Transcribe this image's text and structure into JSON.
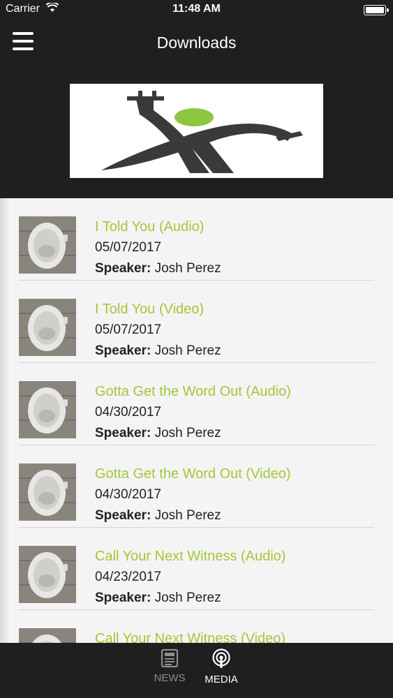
{
  "status_bar": {
    "carrier": "Carrier",
    "time": "11:48 AM"
  },
  "nav": {
    "title": "Downloads"
  },
  "colors": {
    "accent": "#a3c63a",
    "dark": "#1f1f1f"
  },
  "list": {
    "speaker_prefix": "Speaker:",
    "items": [
      {
        "title": "I Told You (Audio)",
        "date": "05/07/2017",
        "speaker": "Josh Perez"
      },
      {
        "title": "I Told You (Video)",
        "date": "05/07/2017",
        "speaker": "Josh Perez"
      },
      {
        "title": "Gotta Get the Word Out (Audio)",
        "date": "04/30/2017",
        "speaker": "Josh Perez"
      },
      {
        "title": "Gotta Get the Word Out (Video)",
        "date": "04/30/2017",
        "speaker": "Josh Perez"
      },
      {
        "title": "Call Your Next Witness (Audio)",
        "date": "04/23/2017",
        "speaker": "Josh Perez"
      },
      {
        "title": "Call Your Next Witness (Video)",
        "date": "",
        "speaker": ""
      }
    ]
  },
  "tabs": [
    {
      "label": "NEWS",
      "icon": "newspaper-icon",
      "active": false
    },
    {
      "label": "MEDIA",
      "icon": "podcast-icon",
      "active": true
    }
  ]
}
